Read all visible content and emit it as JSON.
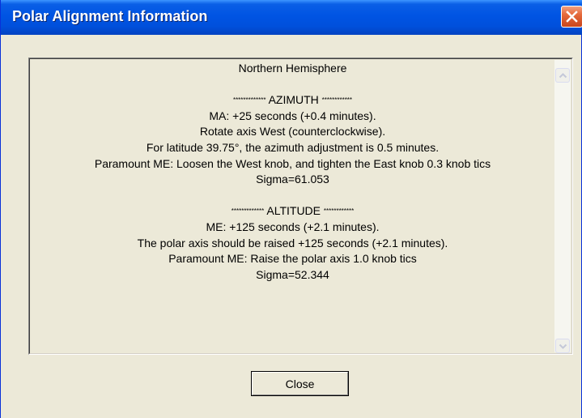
{
  "window": {
    "title": "Polar Alignment Information"
  },
  "report": {
    "hemisphere": "Northern Hemisphere",
    "azimuth": {
      "stars_left": "*************",
      "heading": "AZIMUTH",
      "stars_right": "************",
      "lines": [
        "MA: +25 seconds (+0.4 minutes).",
        "Rotate axis West (counterclockwise).",
        "For latitude 39.75°, the azimuth adjustment is 0.5 minutes.",
        "Paramount ME: Loosen the West knob, and tighten the East knob 0.3 knob tics",
        "Sigma=61.053"
      ]
    },
    "altitude": {
      "stars_left": "*************",
      "heading": "ALTITUDE",
      "stars_right": "************",
      "lines": [
        "ME: +125 seconds (+2.1 minutes).",
        "The polar axis should be raised +125 seconds (+2.1 minutes).",
        "Paramount ME: Raise the polar axis 1.0 knob tics",
        "Sigma=52.344"
      ]
    }
  },
  "buttons": {
    "close_label": "Close"
  },
  "icons": {
    "titlebar_close": "close-icon",
    "scroll_up": "chevron-up-icon",
    "scroll_down": "chevron-down-icon"
  }
}
